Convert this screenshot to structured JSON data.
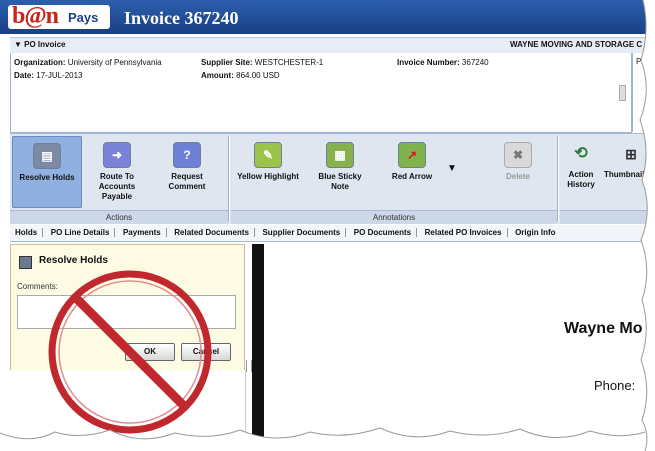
{
  "header": {
    "logo_text": "b@n",
    "logo_sub": "Pays",
    "title": "Invoice 367240"
  },
  "po_section": {
    "label": "▼ PO Invoice",
    "supplier_name": "WAYNE MOVING AND STORAGE C",
    "organization_label": "Organization:",
    "organization": "University of Pennsylvania",
    "supplier_site_label": "Supplier Site:",
    "supplier_site": "WESTCHESTER-1",
    "invoice_number_label": "Invoice Number:",
    "invoice_number": "367240",
    "date_label": "Date:",
    "date": "17-JUL-2013",
    "amount_label": "Amount:",
    "amount": "864.00 USD",
    "right_cut_label": "Pla"
  },
  "toolbar": {
    "actions_group": "Actions",
    "annotations_group": "Annotations",
    "buttons": {
      "resolve_holds": "Resolve Holds",
      "route_to_ap": "Route To Accounts Payable",
      "request_comment": "Request Comment",
      "yellow_highlight": "Yellow Highlight",
      "blue_sticky_note": "Blue Sticky Note",
      "red_arrow": "Red Arrow",
      "delete": "Delete",
      "action_history": "Action History",
      "thumbnails": "Thumbnails"
    }
  },
  "tabs": [
    "Holds",
    "PO Line Details",
    "Payments",
    "Related Documents",
    "Supplier Documents",
    "PO Documents",
    "Related PO Invoices",
    "Origin Info"
  ],
  "resolve_panel": {
    "title": "Resolve Holds",
    "comments_label": "Comments:",
    "comments_value": "",
    "ok_label": "OK",
    "cancel_label": "Cancel"
  },
  "document": {
    "company": "Wayne Mo",
    "phone_label": "Phone:"
  },
  "colors": {
    "header_blue": "#1a3f83",
    "logo_red": "#c8261b",
    "prohibit_red": "#c0282e"
  }
}
